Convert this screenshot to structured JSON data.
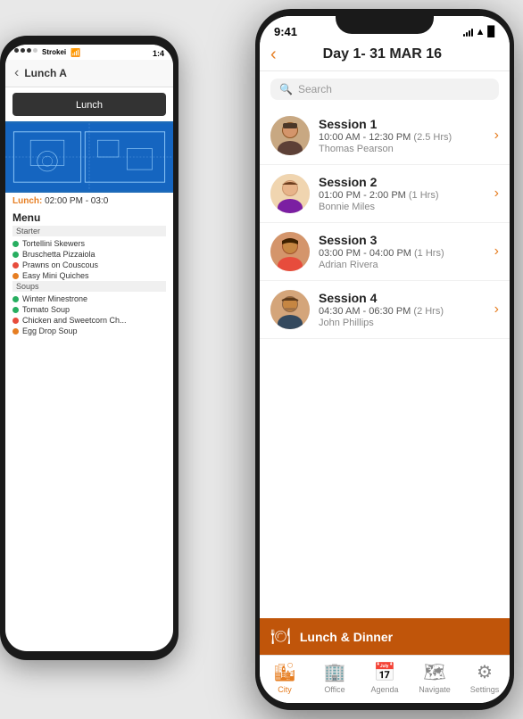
{
  "backPhone": {
    "statusBar": {
      "dots": [
        "active",
        "active",
        "active",
        "inactive"
      ],
      "title": "Strokei",
      "time": "1:4"
    },
    "header": {
      "title": "Lunch A"
    },
    "tab": "Lunch",
    "lunchTime": {
      "label": "Lunch:",
      "time": "02:00 PM - 03:0"
    },
    "menuTitle": "Menu",
    "sections": [
      {
        "name": "Starter",
        "items": [
          {
            "color": "green",
            "text": "Tortellini Skewers"
          },
          {
            "color": "green",
            "text": "Bruschetta Pizzaiola"
          },
          {
            "color": "red",
            "text": "Prawns on Couscous"
          },
          {
            "color": "orange",
            "text": "Easy Mini Quiches"
          }
        ]
      },
      {
        "name": "Soups",
        "items": [
          {
            "color": "green",
            "text": "Winter Minestrone"
          },
          {
            "color": "green",
            "text": "Tomato Soup"
          },
          {
            "color": "red",
            "text": "Chicken and Sweetcorn Ch..."
          },
          {
            "color": "orange",
            "text": "Egg Drop Soup"
          }
        ]
      }
    ]
  },
  "frontPhone": {
    "statusBar": {
      "time": "9:41"
    },
    "header": {
      "backLabel": "‹",
      "title": "Day 1- 31 MAR 16"
    },
    "search": {
      "placeholder": "Search"
    },
    "sessions": [
      {
        "id": 1,
        "title": "Session 1",
        "time": "10:00 AM - 12:30 PM",
        "duration": "(2.5 Hrs)",
        "person": "Thomas Pearson",
        "avatarSeed": "male1"
      },
      {
        "id": 2,
        "title": "Session 2",
        "time": "01:00 PM - 2:00 PM",
        "duration": "(1 Hrs)",
        "person": "Bonnie Miles",
        "avatarSeed": "female1"
      },
      {
        "id": 3,
        "title": "Session 3",
        "time": "03:00 PM - 04:00 PM",
        "duration": "(1 Hrs)",
        "person": "Adrian Rivera",
        "avatarSeed": "female2"
      },
      {
        "id": 4,
        "title": "Session 4",
        "time": "04:30 AM - 06:30 PM",
        "duration": "(2 Hrs)",
        "person": "John Phillips",
        "avatarSeed": "male2"
      }
    ],
    "banner": {
      "icon": "🍽",
      "label": "Lunch & Dinner"
    },
    "tabs": [
      {
        "icon": "🏙",
        "label": "City",
        "active": true
      },
      {
        "icon": "🏢",
        "label": "Office",
        "active": false
      },
      {
        "icon": "📅",
        "label": "Agenda",
        "active": false
      },
      {
        "icon": "🗺",
        "label": "Navigate",
        "active": false
      },
      {
        "icon": "⚙",
        "label": "Settings",
        "active": false
      }
    ]
  }
}
